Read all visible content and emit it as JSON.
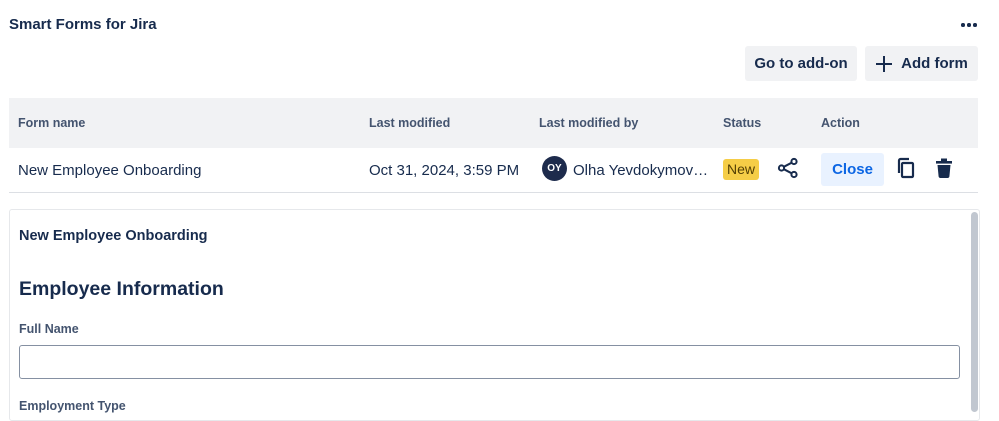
{
  "header": {
    "title": "Smart Forms for Jira",
    "more_icon": "more-horizontal-icon",
    "goto_label": "Go to add-on",
    "add_label": "Add form",
    "add_icon": "plus-icon"
  },
  "table": {
    "columns": [
      "Form name",
      "Last modified",
      "Last modified by",
      "Status",
      "Action"
    ],
    "rows": [
      {
        "form_name": "New Employee Onboarding",
        "last_modified": "Oct 31, 2024, 3:59 PM",
        "avatar_initials": "OY",
        "modified_by": "Olha Yevdokymov…",
        "status": "New",
        "actions": {
          "share_icon": "share-icon",
          "close_label": "Close",
          "copy_icon": "copy-icon",
          "delete_icon": "trash-icon"
        }
      }
    ]
  },
  "preview": {
    "form_title": "New Employee Onboarding",
    "section_title": "Employee Information",
    "fields": [
      {
        "label": "Full Name",
        "value": ""
      },
      {
        "label": "Employment Type"
      }
    ]
  },
  "colors": {
    "status_new_bg": "#f5cd47",
    "close_btn_bg": "#e9f2ff",
    "close_btn_text": "#0c66e4",
    "header_bg": "#f1f2f4",
    "avatar_bg": "#1d2b4c"
  }
}
